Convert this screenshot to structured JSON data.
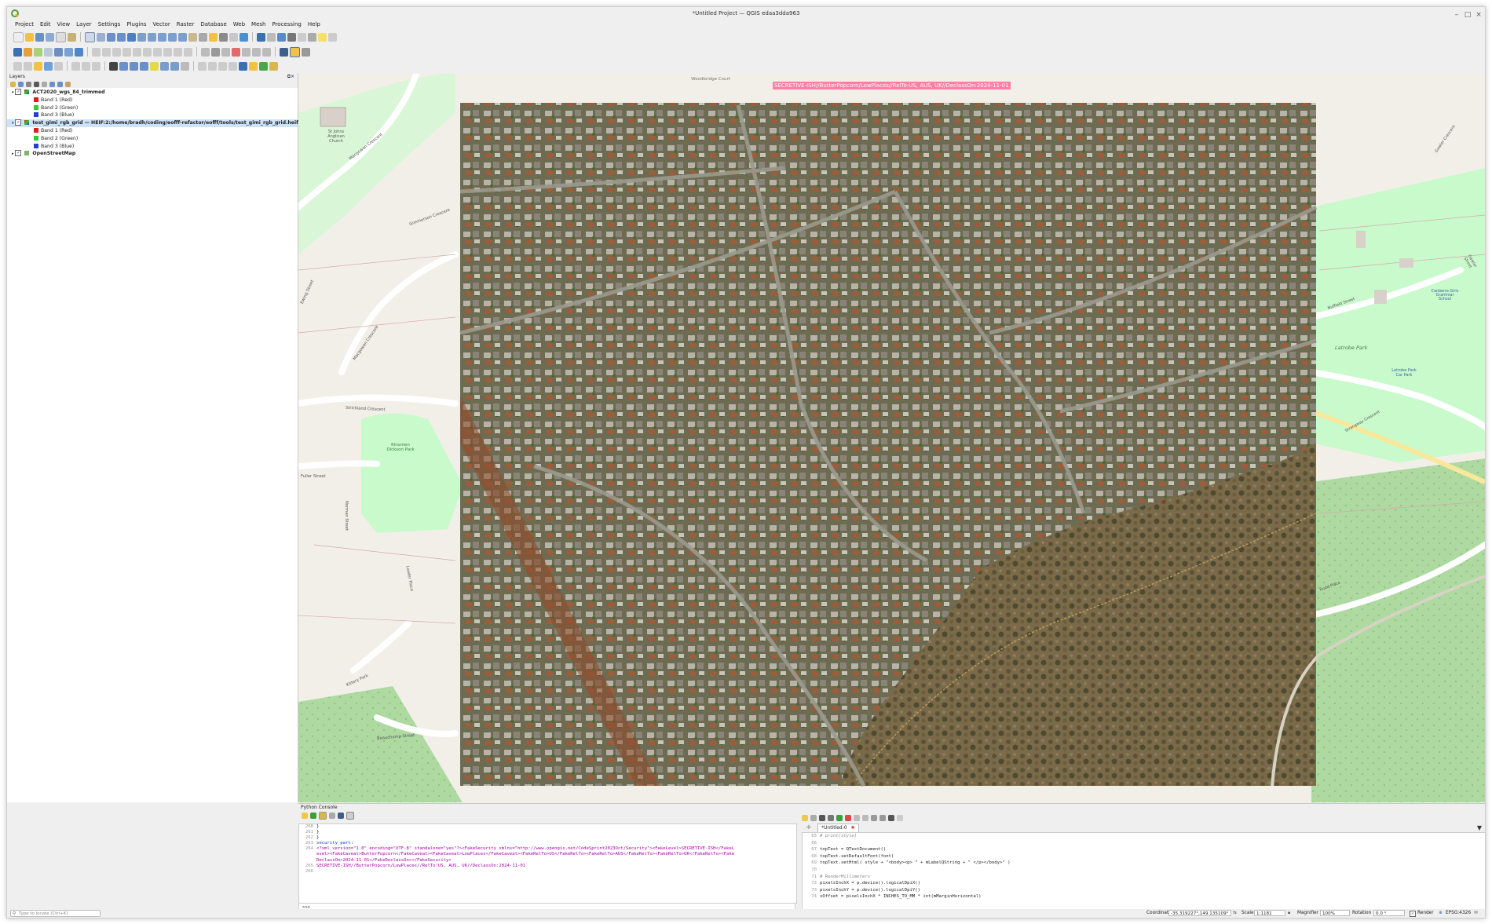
{
  "window": {
    "title": "*Untitled Project — QGIS edaa3dda963",
    "controls": [
      "minimize-icon",
      "maximize-icon",
      "close-icon"
    ]
  },
  "menubar": [
    "Project",
    "Edit",
    "View",
    "Layer",
    "Settings",
    "Plugins",
    "Vector",
    "Raster",
    "Database",
    "Web",
    "Mesh",
    "Processing",
    "Help"
  ],
  "layers_panel": {
    "title": "Layers",
    "rows": [
      {
        "kind": "layer",
        "label": "ACT2020_wgs_84_trimmed",
        "bold": true,
        "checked": true
      },
      {
        "kind": "band",
        "label": "Band 1 (Red)",
        "color": "#e41a1c"
      },
      {
        "kind": "band",
        "label": "Band 2 (Green)",
        "color": "#2ecc2e"
      },
      {
        "kind": "band",
        "label": "Band 3 (Blue)",
        "color": "#1f3fd8"
      },
      {
        "kind": "layer",
        "label": "test_gimi_rgb_grid — HEIF:2:/home/bradh/coding/eofff-refactor/eofff/tools/test_gimi_rgb_grid.heif",
        "bold": true,
        "checked": true,
        "selected": true
      },
      {
        "kind": "band",
        "label": "Band 1 (Red)",
        "color": "#e41a1c"
      },
      {
        "kind": "band",
        "label": "Band 2 (Green)",
        "color": "#2ecc2e"
      },
      {
        "kind": "band",
        "label": "Band 3 (Blue)",
        "color": "#1f3fd8"
      },
      {
        "kind": "layer",
        "label": "OpenStreetMap",
        "bold": true,
        "checked": true
      }
    ]
  },
  "map": {
    "banner": "SECRETIVE-ISH//ButterPopcorn/LowPlaces//RelTo:US, AUS, UK//DeclassOn:2024-11-01",
    "labels": {
      "woodbridge_court": "Woodbridge Court",
      "church": "St Johns Anglican Church",
      "gimi_crescent": "Gimmerson Crescent",
      "ewing_street": "Ewing Street",
      "mcgowan_crescent": "Macgowan Crescent",
      "strickland_crescent": "Strickland Crescent",
      "kinsmen_park": "Kinsmen Dickson Park",
      "fuller_street": "Fuller Street",
      "norman_street": "Norman Street",
      "lawler_place": "Lawler Place",
      "kittery_park": "Kittery Park",
      "beauchamp_street": "Beauchamp Street",
      "lotrobe_park": "Latrobe Park",
      "latrobe_car_park": "Latrobe Park Car Park",
      "canberra_school": "Canberra Girls Grammar School",
      "nuffield_street": "Nuffield Street",
      "gawler_crescent": "Gawler Crescent",
      "strangway_crescent": "Strangway Crescent",
      "gawler_street": "Gawler Street",
      "rudd_place": "Rudd Place"
    }
  },
  "console": {
    "title": "Python Console",
    "output": [
      {
        "n": "260",
        "t": "    }"
      },
      {
        "n": "261",
        "t": "  }"
      },
      {
        "n": "262",
        "t": "}"
      },
      {
        "n": "263",
        "t": "security part:"
      },
      {
        "n": "264",
        "t": "<?xml version=\"1.0\" encoding=\"UTF-8\" standalone=\"yes\"?><FakeSecurity xmlns=\"http://www.opengis.net/CodeSprint2023Oct/Security\"><FakeLevel>SECRETIVE-ISH</FakeL"
      },
      {
        "n": "",
        "t": "evel><FakeCaveat>ButterPopcorn</FakeCaveat><FakeCaveat>LowPlaces</FakeCaveat><FakeRelTo>US</FakeRelTo><FakeRelTo>AUS</FakeRelTo><FakeRelTo>UK</FakeRelTo><Fake"
      },
      {
        "n": "",
        "t": "DeclassOn>2024-11-01</FakeDeclassOn></FakeSecurity>"
      },
      {
        "n": "265",
        "t": "SECRETIVE-ISH//ButterPopcorn/LowPlaces//RelTo:US, AUS, UK//DeclassOn:2024-11-01"
      },
      {
        "n": "266",
        "t": ""
      }
    ],
    "prompt": ">>>",
    "editor_tab": "*Untitled-0",
    "editor": [
      {
        "n": "65",
        "t": "    # print(style)"
      },
      {
        "n": "66",
        "t": ""
      },
      {
        "n": "67",
        "t": "    topText = QTextDocument()"
      },
      {
        "n": "68",
        "t": "    topText.setDefaultFont(font)"
      },
      {
        "n": "69",
        "t": "    topText.setHtml( style + \"<body><p>          \" + mLabelQString + \"          </p></body>\" )"
      },
      {
        "n": "70",
        "t": ""
      },
      {
        "n": "71",
        "t": "    # RenderMillimeters"
      },
      {
        "n": "72",
        "t": "    pixelsInchX  = p.device().logicalDpiX()"
      },
      {
        "n": "73",
        "t": "    pixelsInchY  = p.device().logicalDpiY()"
      },
      {
        "n": "74",
        "t": "    xOffset  = pixelsInchX  * INCHES_TO_MM * int(mMarginHorizontal)"
      }
    ]
  },
  "statusbar": {
    "locate_placeholder": "Type to locate (Ctrl+K)",
    "coordinate_label": "Coordinate",
    "coordinate_value": "-35.319227°,149.135109°",
    "scale_label": "Scale",
    "scale_value": "1:1181",
    "magnifier_label": "Magnifier",
    "magnifier_value": "100%",
    "rotation_label": "Rotation",
    "rotation_value": "0.0 °",
    "render_label": "Render",
    "crs": "EPSG:4326"
  }
}
